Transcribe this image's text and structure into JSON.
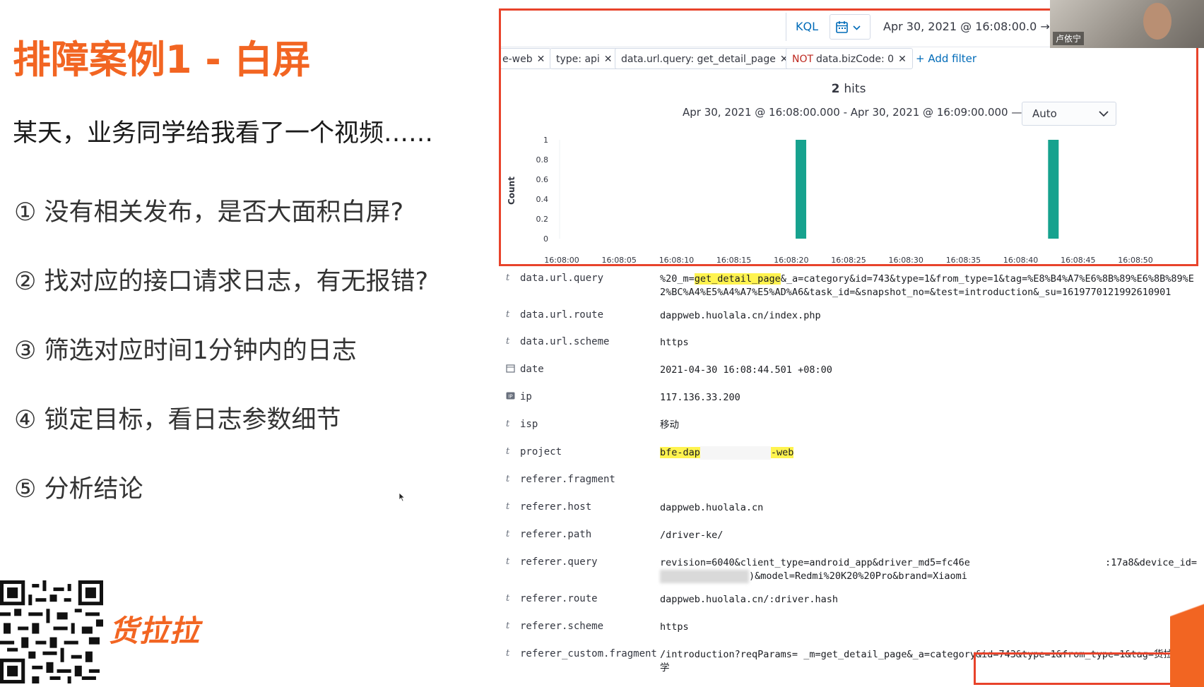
{
  "slide": {
    "title": "排障案例1 - 白屏",
    "subtitle": "某天，业务同学给我看了一个视频……",
    "steps": [
      "① 没有相关发布，是否大面积白屏?",
      "② 找对应的接口请求日志，有无报错?",
      "③ 筛选对应时间1分钟内的日志",
      "④ 锁定目标，看日志参数细节",
      "⑤ 分析结论"
    ],
    "brand": "货拉拉"
  },
  "video": {
    "participant_name": "卢依宁"
  },
  "kibana": {
    "query_language": "KQL",
    "date_range": "Apr 30, 2021 @ 16:08:00.0  →  A",
    "filters": [
      {
        "negated": false,
        "label": "e-web"
      },
      {
        "negated": false,
        "label": "type: api"
      },
      {
        "negated": false,
        "label": "data.url.query: get_detail_page"
      },
      {
        "negated": true,
        "neg_label": "NOT",
        "label": "data.bizCode: 0"
      }
    ],
    "add_filter_label": "+ Add filter",
    "hits_count": "2",
    "hits_label": "hits",
    "interval_range": "Apr 30, 2021 @ 16:08:00.000 - Apr 30, 2021 @ 16:09:00.000 —",
    "interval_value": "Auto",
    "accent_color": "#e8432b",
    "bar_color": "#16a28e"
  },
  "chart_data": {
    "type": "bar",
    "ylabel": "Count",
    "xlabel": "",
    "ylim": [
      0,
      1
    ],
    "y_ticks": [
      "0",
      "0.2",
      "0.4",
      "0.6",
      "0.8",
      "1"
    ],
    "x_ticks": [
      "16:08:00",
      "16:08:05",
      "16:08:10",
      "16:08:15",
      "16:08:20",
      "16:08:25",
      "16:08:30",
      "16:08:35",
      "16:08:40",
      "16:08:45",
      "16:08:50"
    ],
    "x_domain_seconds": [
      0,
      50
    ],
    "series": [
      {
        "values": [
          {
            "x": 21,
            "y": 1
          },
          {
            "x": 43,
            "y": 1
          }
        ]
      }
    ]
  },
  "doc": {
    "rows": [
      {
        "type": "t",
        "field": "data.url.query",
        "value_pre": "%20_m=",
        "value_mark": "get_detail_page",
        "value_post": "&_a=category&id=743&type=1&from_type=1&tag=%E8%B4%A7%E6%8B%89%E6%8B%89%E2%BC%A4%E5%A4%A7%E5%AD%A6&task_id=&snapshot_no=&test=introduction&_su=1619770121992610901"
      },
      {
        "type": "t",
        "field": "data.url.route",
        "value": "dappweb.huolala.cn/index.php"
      },
      {
        "type": "t",
        "field": "data.url.scheme",
        "value": "https"
      },
      {
        "type": "calendar",
        "field": "date",
        "value": "2021-04-30 16:08:44.501 +08:00"
      },
      {
        "type": "IP",
        "field": "ip",
        "value": "117.136.33.200"
      },
      {
        "type": "t",
        "field": "isp",
        "value": "移动"
      },
      {
        "type": "t",
        "field": "project",
        "value_mark_a": "bfe-dap",
        "value_mark_b": "-web"
      },
      {
        "type": "t",
        "field": "referer.fragment",
        "value": ""
      },
      {
        "type": "t",
        "field": "referer.host",
        "value": "dappweb.huolala.cn"
      },
      {
        "type": "t",
        "field": "referer.path",
        "value": "/driver-ke/"
      },
      {
        "type": "t",
        "field": "referer.query",
        "value_line1a": "revision=6040&client_type=android_app&driver_md5=fc46e",
        "value_line1b": ":17a8&device_id=",
        "value_line2": ")&model=Redmi%20K20%20Pro&brand=Xiaomi"
      },
      {
        "type": "t",
        "field": "referer.route",
        "value": "dappweb.huolala.cn/:driver.hash"
      },
      {
        "type": "t",
        "field": "referer.scheme",
        "value": "https"
      },
      {
        "type": "t",
        "field": "referer_custom.fragment",
        "value": "/introduction?reqParams= _m=get_detail_page&_a=category&id=743&type=1&from_type=1&tag=货拉拉大学"
      }
    ]
  }
}
